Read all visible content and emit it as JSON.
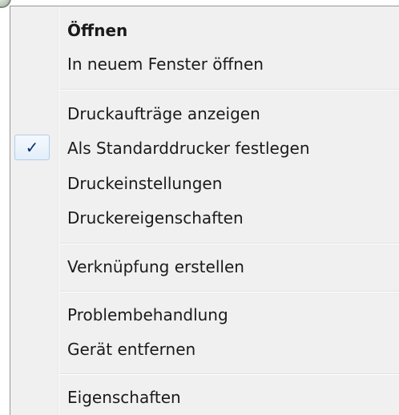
{
  "menu": {
    "items": [
      {
        "label": "Öffnen"
      },
      {
        "label": "In neuem Fenster öffnen"
      },
      {
        "label": "Druckaufträge anzeigen"
      },
      {
        "label": "Als Standarddrucker festlegen",
        "checked": true
      },
      {
        "label": "Druckeinstellungen"
      },
      {
        "label": "Druckereigenschaften"
      },
      {
        "label": "Verknüpfung erstellen"
      },
      {
        "label": "Problembehandlung"
      },
      {
        "label": "Gerät entfernen"
      },
      {
        "label": "Eigenschaften"
      }
    ],
    "check_glyph": "✓"
  },
  "colors": {
    "menu_background": "#f0f0f0",
    "menu_border": "#979797",
    "check_color": "#0c2d6b",
    "check_highlight_border": "#b0cde9"
  }
}
